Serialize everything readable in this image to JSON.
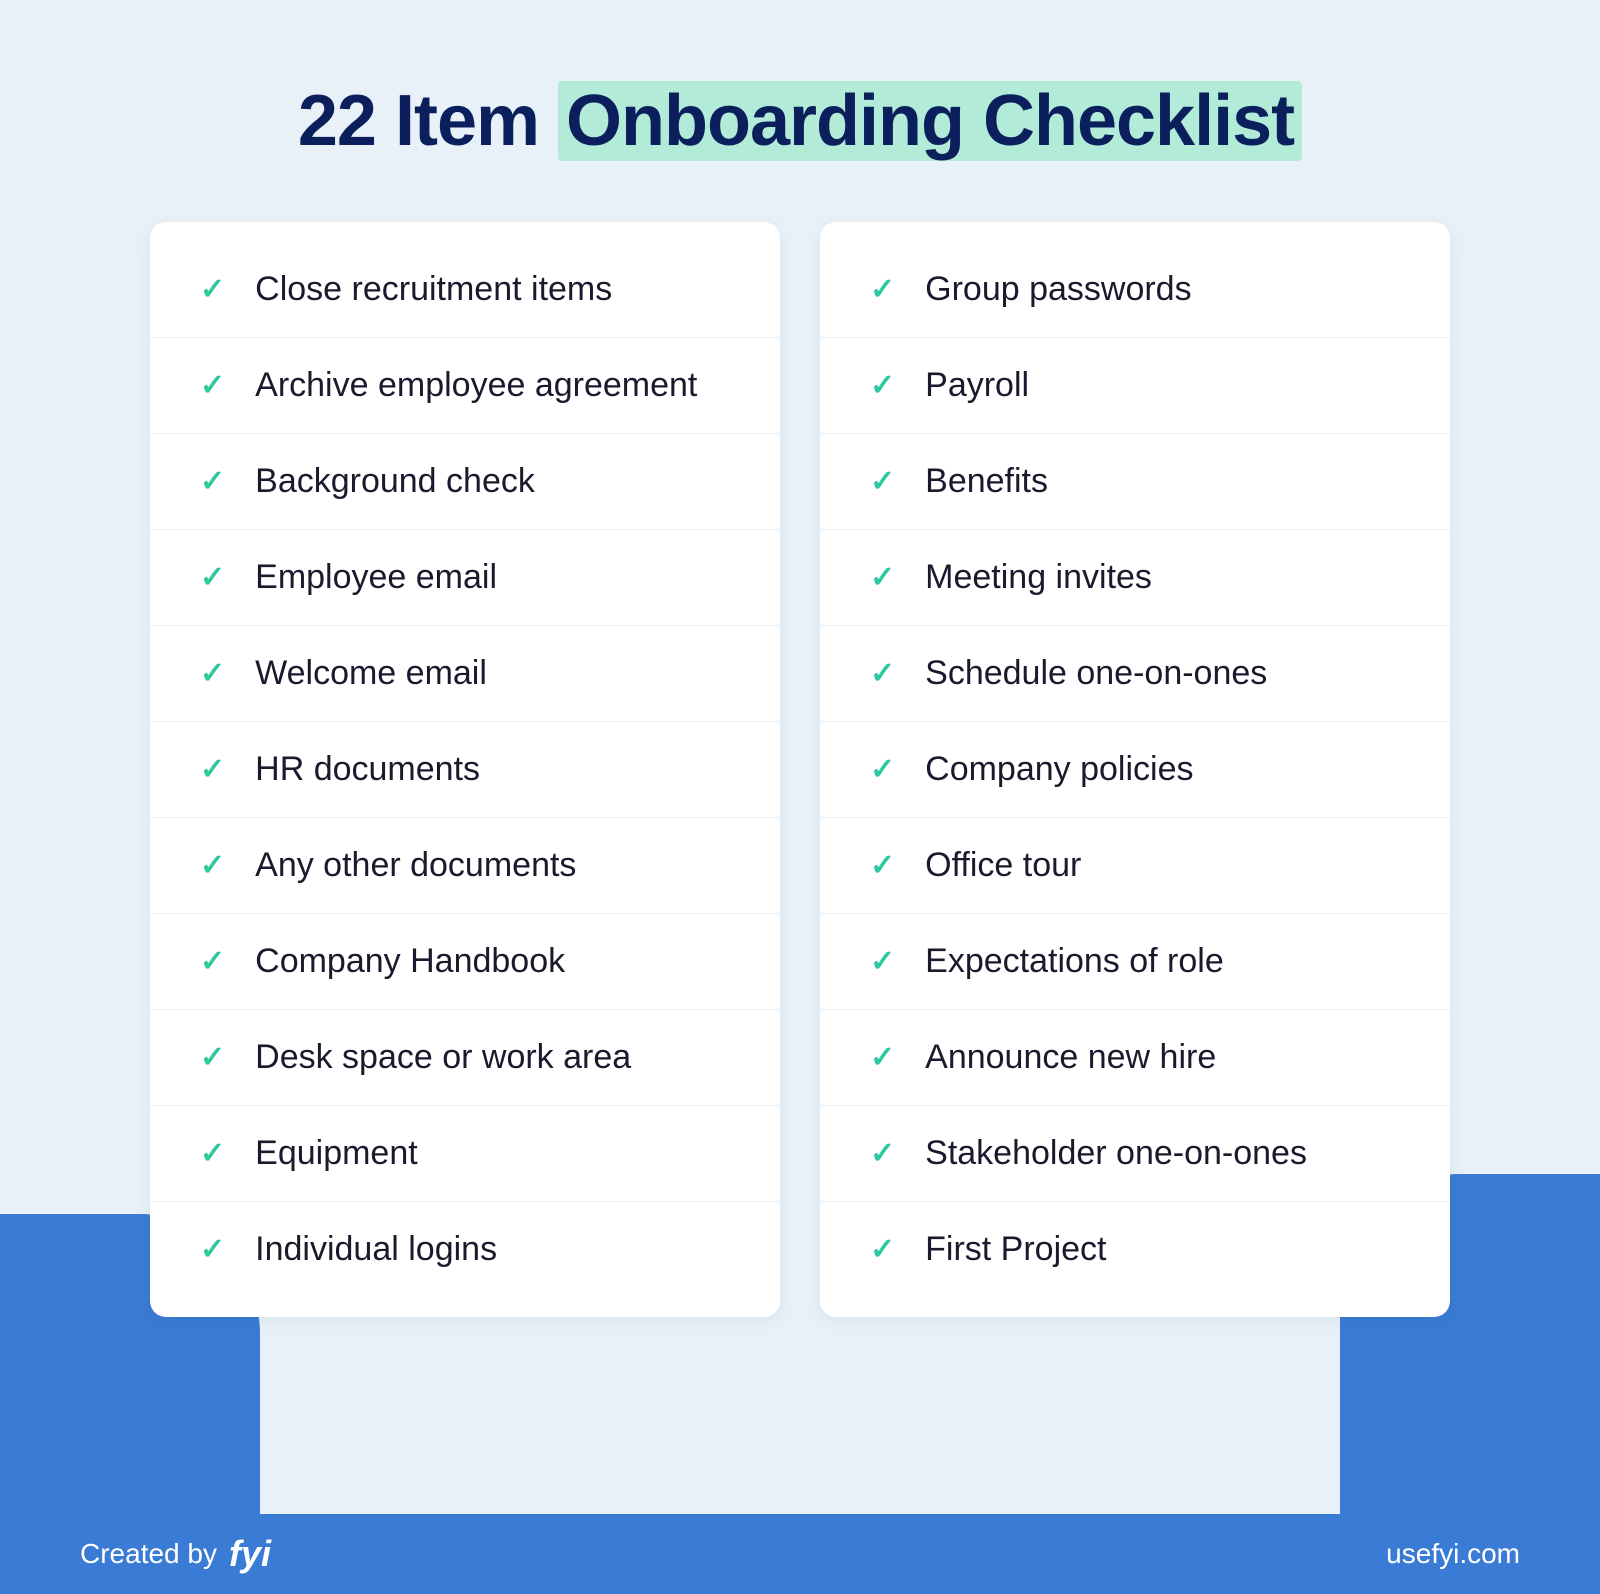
{
  "header": {
    "title_part1": "22 Item ",
    "title_part2": "Onboarding Checklist"
  },
  "left_column": {
    "items": [
      "Close recruitment items",
      "Archive employee agreement",
      "Background check",
      "Employee email",
      "Welcome email",
      "HR documents",
      "Any other documents",
      "Company Handbook",
      "Desk space or work area",
      "Equipment",
      "Individual logins"
    ]
  },
  "right_column": {
    "items": [
      "Group passwords",
      "Payroll",
      "Benefits",
      "Meeting invites",
      "Schedule one-on-ones",
      "Company policies",
      "Office tour",
      "Expectations of role",
      "Announce new hire",
      "Stakeholder one-on-ones",
      "First Project"
    ]
  },
  "footer": {
    "created_by_label": "Created by",
    "logo_text": "fyi",
    "website": "usefyi.com"
  },
  "icons": {
    "check": "✓"
  }
}
